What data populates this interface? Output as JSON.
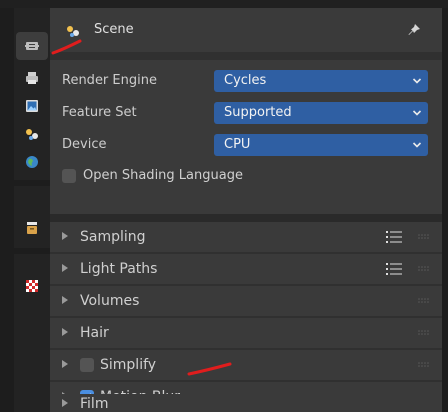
{
  "header": {
    "title": "Scene"
  },
  "tabs": [
    {
      "name": "render-tab",
      "icon": "camera-back-icon",
      "active": true
    },
    {
      "name": "output-tab",
      "icon": "printer-icon",
      "active": false
    },
    {
      "name": "view-layer-tab",
      "icon": "image-icon",
      "active": false
    },
    {
      "name": "scene-tab",
      "icon": "scene-icon",
      "active": false
    },
    {
      "name": "world-tab",
      "icon": "world-icon",
      "active": false
    },
    {
      "name": "collection-tab",
      "icon": "collection-icon",
      "active": false
    },
    {
      "name": "texture-tab",
      "icon": "checker-icon",
      "active": false
    }
  ],
  "properties": {
    "render_engine": {
      "label": "Render Engine",
      "value": "Cycles"
    },
    "feature_set": {
      "label": "Feature Set",
      "value": "Supported"
    },
    "device": {
      "label": "Device",
      "value": "CPU"
    },
    "open_shading_language": {
      "label": "Open Shading Language",
      "checked": false
    }
  },
  "sections": [
    {
      "label": "Sampling",
      "has_presets": true
    },
    {
      "label": "Light Paths",
      "has_presets": true
    },
    {
      "label": "Volumes",
      "has_presets": false
    },
    {
      "label": "Hair",
      "has_presets": false
    },
    {
      "label": "Simplify",
      "checkbox": true,
      "checked": false
    },
    {
      "label": "Motion Blur",
      "checkbox": true,
      "checked": true
    },
    {
      "label": "Film",
      "has_presets": false
    }
  ],
  "colors": {
    "accent_blue": "#2f5fa3",
    "checkbox_checked": "#4a8ee0",
    "annotation_red": "#e01d1d"
  }
}
